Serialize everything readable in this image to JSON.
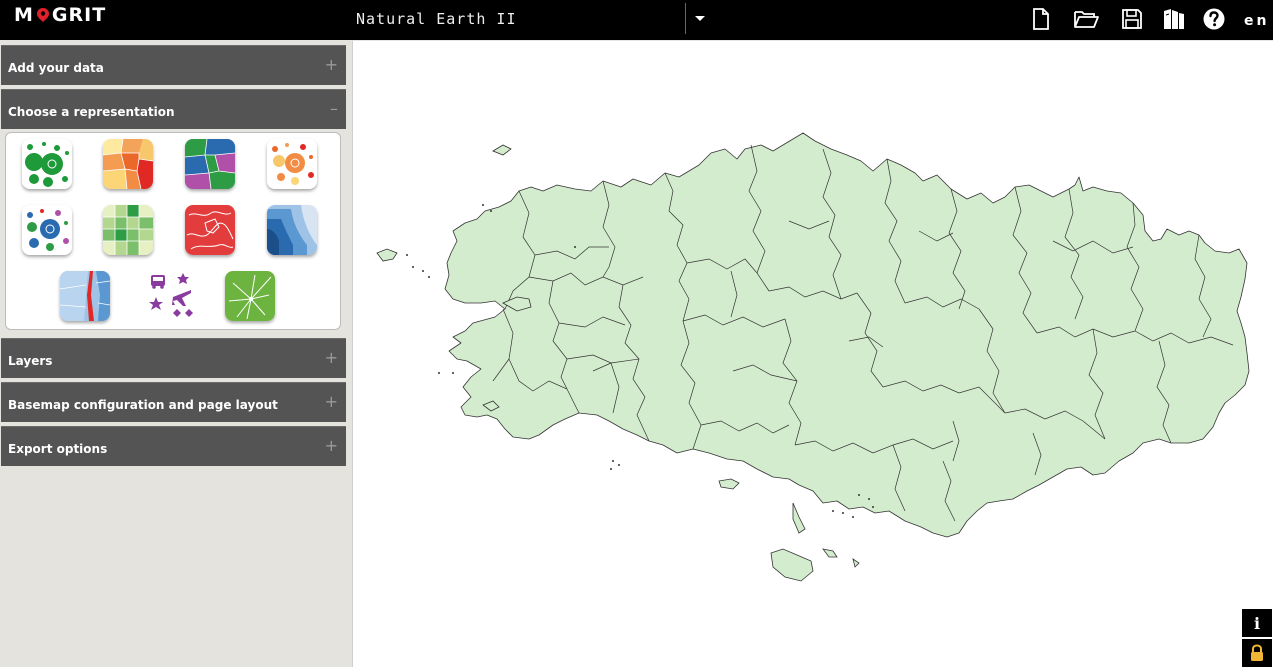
{
  "app": {
    "logo": {
      "left": "M",
      "right": "GRIT",
      "pin_color": "#e0202a"
    },
    "basemap_name": "Natural Earth II",
    "language": "en"
  },
  "toolbar": {
    "icons": [
      "new-project-icon",
      "open-project-icon",
      "save-project-icon",
      "documentation-icon",
      "help-icon"
    ]
  },
  "sidebar": {
    "sections": [
      {
        "label": "Add your data",
        "toggle": "+"
      },
      {
        "label": "Choose a representation",
        "toggle": "–"
      },
      {
        "label": "Layers",
        "toggle": "+"
      },
      {
        "label": "Basemap configuration and page layout",
        "toggle": "+"
      },
      {
        "label": "Export options",
        "toggle": "+"
      }
    ],
    "representations": [
      "proportional-symbols",
      "choropleth",
      "categorical",
      "proportional-choropleth",
      "proportional-categorical",
      "grid",
      "smoothed",
      "discontinuities",
      "flows",
      "labels",
      "links"
    ]
  },
  "map": {
    "fill_color": "#d4ecce",
    "stroke_color": "#333333"
  },
  "corner": {
    "info_label": "i",
    "lock_icon": "lock-icon"
  },
  "colors": {
    "topbar": "#000000",
    "section": "#545454",
    "sidebar": "#e4e3de"
  }
}
